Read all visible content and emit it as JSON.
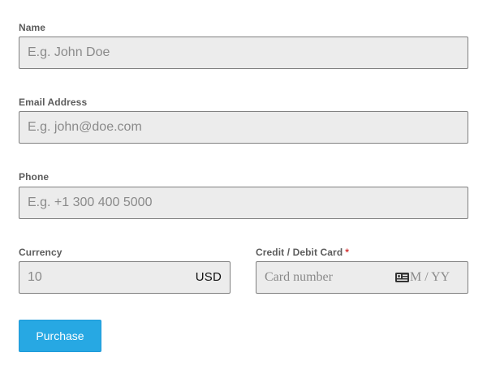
{
  "form": {
    "name": {
      "label": "Name",
      "placeholder": "E.g. John Doe",
      "value": ""
    },
    "email": {
      "label": "Email Address",
      "placeholder": "E.g. john@doe.com",
      "value": ""
    },
    "phone": {
      "label": "Phone",
      "placeholder": "E.g. +1 300 400 5000",
      "value": ""
    },
    "currency": {
      "label": "Currency",
      "placeholder": "10",
      "value": "",
      "code": "USD"
    },
    "card": {
      "label": "Credit / Debit Card",
      "required_mark": "*",
      "number_placeholder": "Card number",
      "expiry_placeholder": "M / YY",
      "icon": "card-icon"
    },
    "submit_label": "Purchase"
  },
  "colors": {
    "button_background": "#27a8e3",
    "field_background": "#ececec",
    "required_mark": "#d43a3a"
  }
}
